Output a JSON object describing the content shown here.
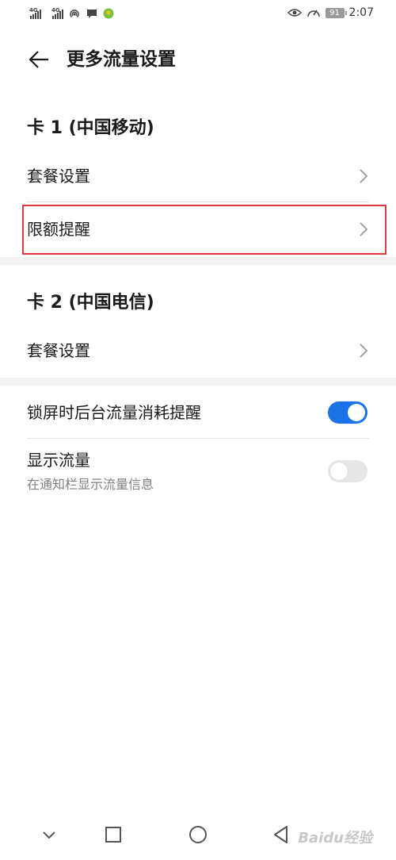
{
  "status_bar": {
    "time": "2:07",
    "battery": "91",
    "network1": "4G",
    "network2": "4G"
  },
  "header": {
    "title": "更多流量设置"
  },
  "card1": {
    "title": "卡 1 (中国移动)",
    "items": [
      {
        "label": "套餐设置"
      },
      {
        "label": "限额提醒"
      }
    ]
  },
  "card2": {
    "title": "卡 2 (中国电信)",
    "items": [
      {
        "label": "套餐设置"
      }
    ]
  },
  "settings": {
    "lockscreen": {
      "label": "锁屏时后台流量消耗提醒",
      "enabled": true
    },
    "show_traffic": {
      "label": "显示流量",
      "sublabel": "在通知栏显示流量信息",
      "enabled": false
    }
  },
  "colors": {
    "accent": "#1a73e8",
    "highlight": "#e0393e"
  },
  "watermark": "Baidu经验"
}
